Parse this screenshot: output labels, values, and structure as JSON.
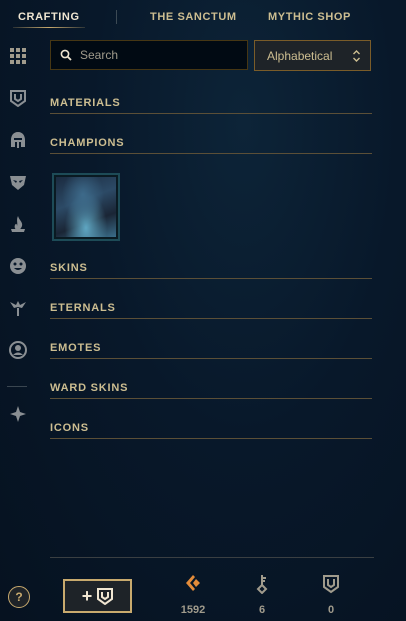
{
  "tabs": [
    {
      "label": "CRAFTING",
      "active": true
    },
    {
      "label": "THE SANCTUM",
      "active": false
    },
    {
      "label": "MYTHIC SHOP",
      "active": false
    }
  ],
  "sidebar": {
    "icons": [
      "grid-icon",
      "chest-icon",
      "champion-helmet-icon",
      "mask-icon",
      "fire-icon",
      "emote-face-icon",
      "ward-icon",
      "profile-icon",
      "compass-icon"
    ]
  },
  "search": {
    "placeholder": "Search",
    "value": ""
  },
  "sort": {
    "selected": "Alphabetical"
  },
  "sections": [
    {
      "title": "MATERIALS"
    },
    {
      "title": "CHAMPIONS"
    },
    {
      "title": "SKINS"
    },
    {
      "title": "ETERNALS"
    },
    {
      "title": "EMOTES"
    },
    {
      "title": "WARD SKINS"
    },
    {
      "title": "ICONS"
    }
  ],
  "champions": [
    {
      "icon": "champion-portrait"
    }
  ],
  "footer": {
    "help_label": "?",
    "unlock_plus": "+",
    "currencies": [
      {
        "icon": "orange-essence-icon",
        "value": "1592",
        "color": "#e38c3a"
      },
      {
        "icon": "key-icon",
        "value": "6",
        "color": "#a09b8c"
      },
      {
        "icon": "chest-icon",
        "value": "0",
        "color": "#a09b8c"
      }
    ]
  },
  "colors": {
    "gold": "#c8aa6e",
    "gold_light": "#f0e6d2",
    "divider": "#5b4f37",
    "background": "#08182a",
    "essence_orange": "#e38c3a"
  }
}
